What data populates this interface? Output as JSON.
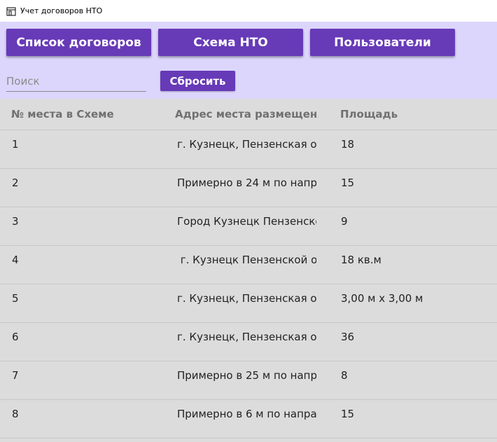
{
  "window": {
    "title": "Учет договоров НТО",
    "icon": "window-app-icon"
  },
  "toolbar": {
    "nav_buttons": [
      {
        "label": "Список договоров"
      },
      {
        "label": "Схема НТО"
      },
      {
        "label": "Пользователи"
      }
    ],
    "search": {
      "value": "",
      "placeholder": "Поиск"
    },
    "reset_label": "Сбросить"
  },
  "colors": {
    "accent": "#673ab7",
    "toolbar_bg": "#dcd6fd",
    "grid_bg": "#dcdcdc"
  },
  "table": {
    "columns": [
      "№ места в Схеме",
      "Адрес места размещен...",
      "Площадь"
    ],
    "rows": [
      {
        "num": "1",
        "address": "г. Кузнецк, Пензенская об",
        "area": "18"
      },
      {
        "num": "2",
        "address": "Примерно в 24 м по напр",
        "area": "15"
      },
      {
        "num": "3",
        "address": "Город Кузнецк Пензенско",
        "area": "9"
      },
      {
        "num": "4",
        "address": " г. Кузнецк Пензенской об",
        "area": "18 кв.м"
      },
      {
        "num": "5",
        "address": "г. Кузнецк, Пензенская об",
        "area": "3,00 м х 3,00 м"
      },
      {
        "num": "6",
        "address": "г. Кузнецк, Пензенская об",
        "area": "36"
      },
      {
        "num": "7",
        "address": "Примерно в 25 м по напр",
        "area": "8"
      },
      {
        "num": "8",
        "address": "Примерно в 6 м по напра",
        "area": "15"
      }
    ]
  }
}
